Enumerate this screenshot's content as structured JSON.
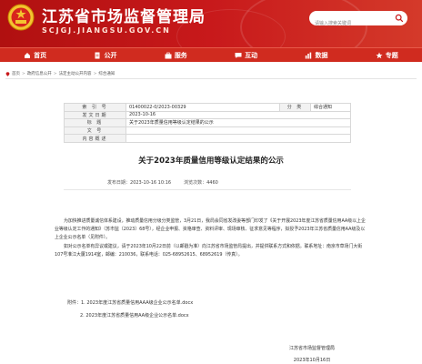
{
  "header": {
    "title": "江苏省市场监督管理局",
    "domain": "SCJGJ.JIANGSU.GOV.CN",
    "search_placeholder": "请输入搜索关键词"
  },
  "nav": [
    {
      "label": "首页",
      "icon": "home-icon"
    },
    {
      "label": "公开",
      "icon": "document-icon"
    },
    {
      "label": "服务",
      "icon": "briefcase-icon"
    },
    {
      "label": "互动",
      "icon": "chat-icon"
    },
    {
      "label": "数据",
      "icon": "chart-icon"
    },
    {
      "label": "专题",
      "icon": "star-icon"
    }
  ],
  "breadcrumb": [
    "首页",
    "政府信息公开",
    "法定主动公开内容",
    "综合通知"
  ],
  "meta": {
    "index_label": "索 引 号",
    "index_value": "01400022-0/2023-00329",
    "category_label": "分 类",
    "category_value": "综合通知",
    "date_label": "发文日期",
    "date_value": "2023-10-16",
    "title_label": "标 题",
    "title_value": "关于2023年质量信用等级认定结果的公示",
    "docno_label": "文 号",
    "docno_value": "",
    "summary_label": "内容概述",
    "summary_value": ""
  },
  "article": {
    "title": "关于2023年质量信用等级认定结果的公示",
    "pub_label": "发布日期：",
    "pub_value": "2023-10-16 10:16",
    "views_label": "浏览次数：",
    "views_value": "4460",
    "paragraphs": [
      "为加快推进质量诚信体系建设，推动质量信用分级分类监管，3月21日，我局会同省发改委等部门印发了《关于开展2023年度江苏省质量信用AA级以上企业等级认定工作的通知》（苏市监〔2023〕68号），经企业申报、资格审查、资料评审、现场审核、征求意见等程序，拟授予2023年江苏省质量信用AA级及以上企业公示名单（见附件）。",
      "如对公示名单有异议或建议，请于2023年10月22日前（以邮戳为准）向江苏省市场监管局提出，并提供联系方式和依据。联系地址：南京市草场门大街107号准江大厦1914室，邮编：210036，联系电话：025-68952615、68952619（传真）。"
    ],
    "attachments": [
      "附件：1. 2023年度江苏省质量信用AAA级企业公示名单.docx",
      "2. 2023年度江苏省质量信用AA级企业公示名单.docx"
    ],
    "signature_org": "江苏省市场监督管理局",
    "signature_date": "2023年10月16日"
  }
}
